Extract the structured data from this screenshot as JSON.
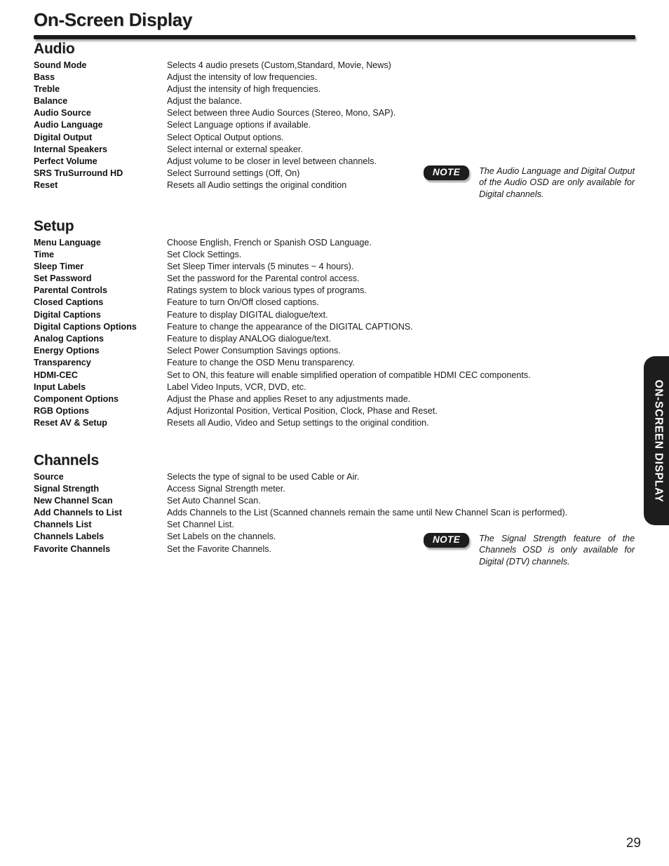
{
  "header": {
    "title": "On-Screen Display"
  },
  "side_tab": {
    "label": "ON-SCREEN DISPLAY"
  },
  "page_number": "29",
  "sections": [
    {
      "heading": "Audio",
      "rows": [
        {
          "label": "Sound Mode",
          "desc": "Selects 4 audio presets (Custom,Standard, Movie, News)"
        },
        {
          "label": "Bass",
          "desc": "Adjust the intensity of low frequencies."
        },
        {
          "label": "Treble",
          "desc": "Adjust the intensity of high frequencies."
        },
        {
          "label": "Balance",
          "desc": "Adjust the balance."
        },
        {
          "label": "Audio Source",
          "desc": "Select between three Audio Sources (Stereo, Mono, SAP)."
        },
        {
          "label": "Audio Language",
          "desc": "Select Language options if available."
        },
        {
          "label": "Digital Output",
          "desc": "Select Optical Output options."
        },
        {
          "label": "Internal Speakers",
          "desc": "Select internal or external speaker."
        },
        {
          "label": "Perfect Volume",
          "desc": "Adjust volume to be closer in level between channels."
        },
        {
          "label": "SRS TruSurround HD",
          "desc": "Select Surround settings (Off, On)"
        },
        {
          "label": "Reset",
          "desc": "Resets all Audio settings the original condition"
        }
      ]
    },
    {
      "heading": "Setup",
      "rows": [
        {
          "label": "Menu Language",
          "desc": "Choose English, French or Spanish OSD Language."
        },
        {
          "label": "Time",
          "desc": "Set Clock Settings."
        },
        {
          "label": "Sleep Timer",
          "desc": "Set Sleep Timer intervals (5 minutes ~ 4 hours)."
        },
        {
          "label": "Set Password",
          "desc": "Set the password for the Parental control access."
        },
        {
          "label": "Parental Controls",
          "desc": "Ratings system to block various types of programs."
        },
        {
          "label": "Closed Captions",
          "desc": "Feature to turn On/Off closed captions."
        },
        {
          "label": "Digital Captions",
          "desc": "Feature to display DIGITAL dialogue/text."
        },
        {
          "label": "Digital Captions Options",
          "desc": "Feature to change the appearance of the DIGITAL CAPTIONS."
        },
        {
          "label": "Analog Captions",
          "desc": "Feature to display ANALOG dialogue/text."
        },
        {
          "label": "Energy Options",
          "desc": "Select Power Consumption Savings options."
        },
        {
          "label": "Transparency",
          "desc": "Feature to change the OSD Menu transparency."
        },
        {
          "label": "HDMI-CEC",
          "desc": "Set to ON, this feature will enable simplified operation of compatible HDMI CEC components."
        },
        {
          "label": "Input Labels",
          "desc": "Label Video Inputs, VCR, DVD, etc."
        },
        {
          "label": "Component Options",
          "desc": "Adjust the Phase and applies Reset to any adjustments made."
        },
        {
          "label": "RGB Options",
          "desc": "Adjust Horizontal Position, Vertical Position, Clock, Phase and Reset."
        },
        {
          "label": "Reset AV & Setup",
          "desc": "Resets all Audio, Video and Setup settings to the original condition."
        }
      ]
    },
    {
      "heading": "Channels",
      "rows": [
        {
          "label": "Source",
          "desc": "Selects the type of signal to be used Cable or Air."
        },
        {
          "label": "Signal Strength",
          "desc": "Access Signal Strength meter."
        },
        {
          "label": "New Channel Scan",
          "desc": "Set Auto Channel Scan."
        },
        {
          "label": "Add Channels to List",
          "desc": "Adds Channels to the List (Scanned channels remain the same until New Channel Scan is performed)."
        },
        {
          "label": "Channels List",
          "desc": "Set Channel List."
        },
        {
          "label": "Channels Labels",
          "desc": "Set Labels on the channels."
        },
        {
          "label": "Favorite Channels",
          "desc": "Set the Favorite Channels."
        }
      ]
    }
  ],
  "notes": [
    {
      "badge": "NOTE",
      "text": "The Audio Language and Digital Output of the Audio OSD are only available for Digital channels."
    },
    {
      "badge": "NOTE",
      "text": "The Signal Strength feature of the Channels OSD is only available for Digital (DTV) channels."
    }
  ]
}
